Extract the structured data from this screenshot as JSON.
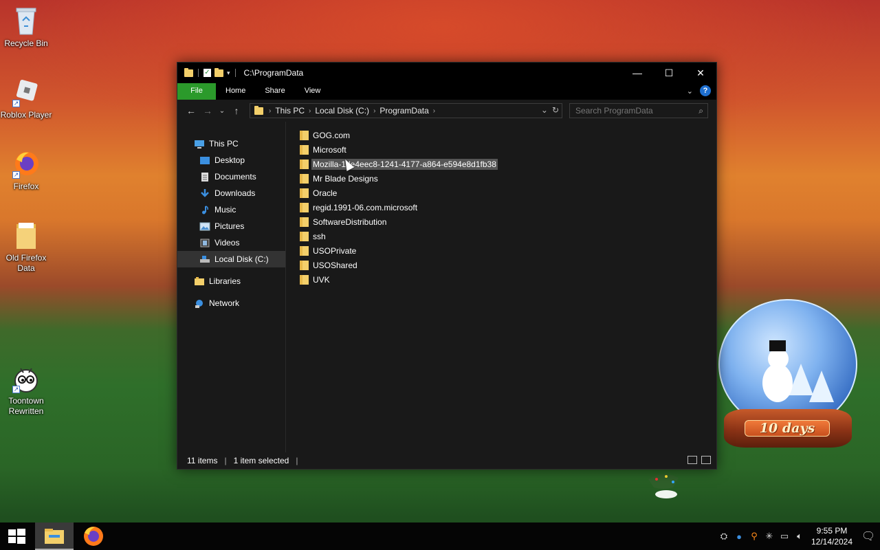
{
  "desktop": {
    "icons": [
      {
        "label": "Recycle Bin"
      },
      {
        "label": "Roblox Player"
      },
      {
        "label": "Firefox"
      },
      {
        "label": "Old Firefox Data"
      },
      {
        "label": "Toontown Rewritten"
      }
    ]
  },
  "window": {
    "title": "C:\\ProgramData",
    "controls": {
      "minimize": "—",
      "maximize": "☐",
      "close": "✕"
    },
    "ribbon": {
      "tabs": [
        "File",
        "Home",
        "Share",
        "View"
      ],
      "help": "?"
    },
    "address": {
      "crumbs": [
        "This PC",
        "Local Disk (C:)",
        "ProgramData"
      ]
    },
    "search": {
      "placeholder": "Search ProgramData"
    },
    "sidebar": {
      "items": [
        {
          "label": "This PC",
          "icon": "pc-icon"
        },
        {
          "label": "Desktop",
          "icon": "desktop-icon"
        },
        {
          "label": "Documents",
          "icon": "documents-icon"
        },
        {
          "label": "Downloads",
          "icon": "downloads-icon"
        },
        {
          "label": "Music",
          "icon": "music-icon"
        },
        {
          "label": "Pictures",
          "icon": "pictures-icon"
        },
        {
          "label": "Videos",
          "icon": "videos-icon"
        },
        {
          "label": "Local Disk (C:)",
          "icon": "drive-icon",
          "selected": true
        },
        {
          "label": "Libraries",
          "icon": "libraries-icon"
        },
        {
          "label": "Network",
          "icon": "network-icon"
        }
      ]
    },
    "files": [
      {
        "name": "GOG.com"
      },
      {
        "name": "Microsoft"
      },
      {
        "name": "Mozilla-1de4eec8-1241-4177-a864-e594e8d1fb38",
        "selected": true
      },
      {
        "name": "Mr Blade Designs"
      },
      {
        "name": "Oracle"
      },
      {
        "name": "regid.1991-06.com.microsoft"
      },
      {
        "name": "SoftwareDistribution"
      },
      {
        "name": "ssh"
      },
      {
        "name": "USOPrivate"
      },
      {
        "name": "USOShared"
      },
      {
        "name": "UVK"
      }
    ],
    "status": {
      "count": "11 items",
      "selected": "1 item selected"
    }
  },
  "widget": {
    "countdown": "10 days"
  },
  "taskbar": {
    "clock_time": "9:55 PM",
    "clock_date": "12/14/2024"
  },
  "colors": {
    "accent_file_tab": "#2b9a2b",
    "folder": "#f3cf6a",
    "window_bg": "#191919"
  }
}
